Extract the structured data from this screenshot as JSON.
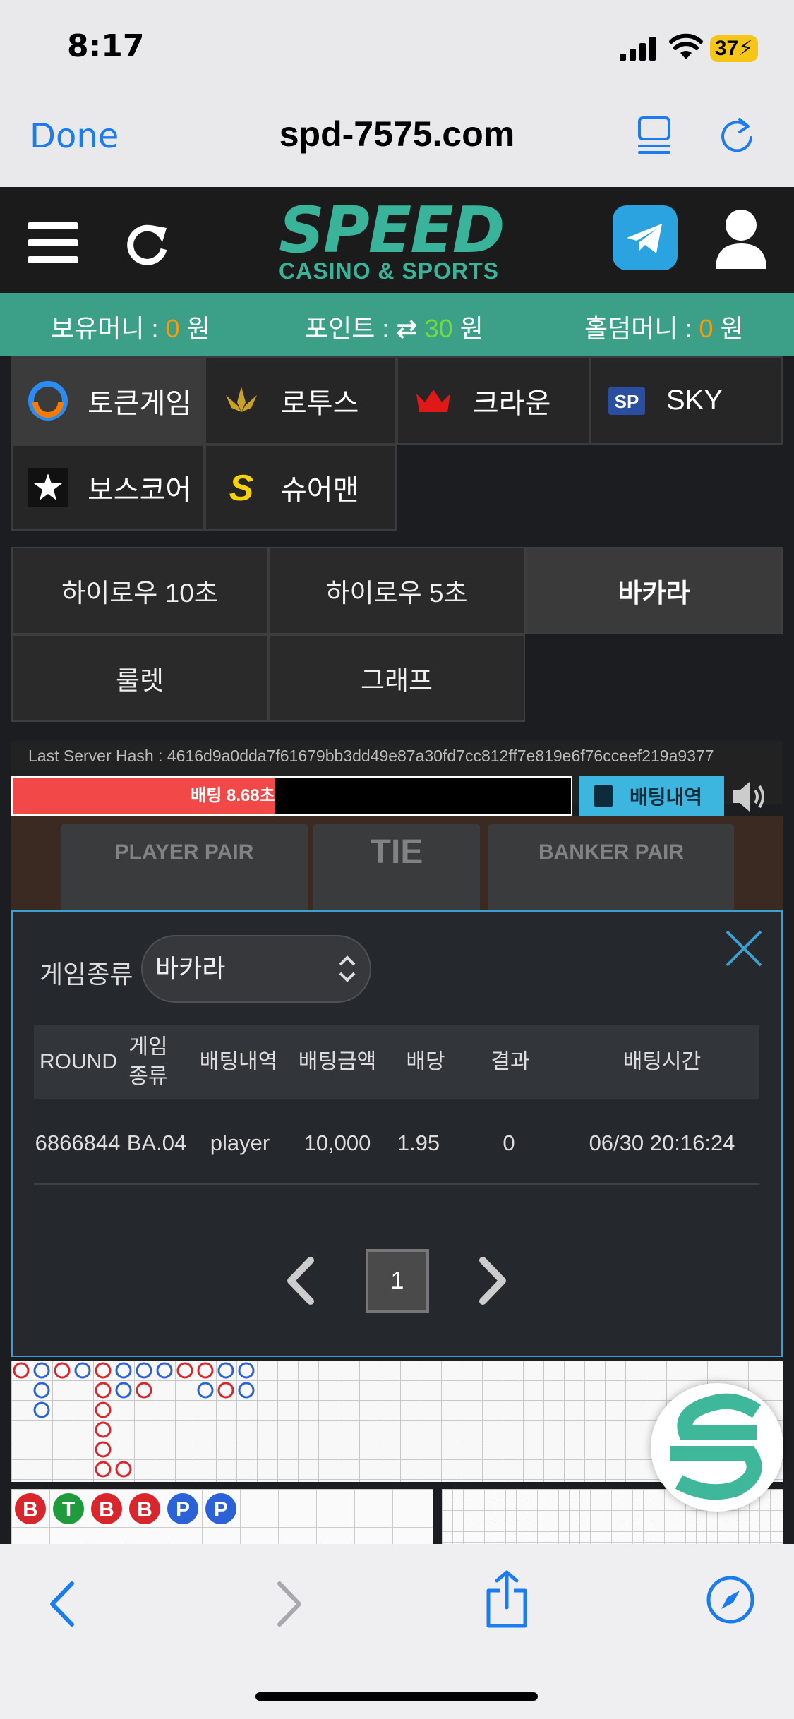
{
  "status": {
    "time": "8:17",
    "battery": "37"
  },
  "browser": {
    "done_label": "Done",
    "url": "spd-7575.com"
  },
  "logo": {
    "line1": "SPEED",
    "line2": "CASINO & SPORTS"
  },
  "money": {
    "held_label": "보유머니 :",
    "held_value": "0",
    "held_unit": "원",
    "point_label": "포인트 :",
    "point_value": "30",
    "point_unit": "원",
    "holdem_label": "홀덤머니 :",
    "holdem_value": "0",
    "holdem_unit": "원"
  },
  "providers": [
    {
      "label": "토큰게임",
      "icon": "token-game-icon"
    },
    {
      "label": "로투스",
      "icon": "lotus-icon"
    },
    {
      "label": "크라운",
      "icon": "crown-icon"
    },
    {
      "label": "SKY",
      "icon": "sky-icon"
    },
    {
      "label": "보스코어",
      "icon": "boscore-icon"
    },
    {
      "label": "슈어맨",
      "icon": "sureman-icon"
    }
  ],
  "game_tabs": [
    "하이로우 10초",
    "하이로우 5초",
    "바카라",
    "룰렛",
    "그래프"
  ],
  "hash": "Last Server Hash : 4616d9a0dda7f61679bb3dd49e87a30fd7cc812ff7e819e6f76cceef219a9377",
  "bet": {
    "timer_text": "배팅 8.68초",
    "progress": 0.47,
    "history_label": "배팅내역"
  },
  "pairs": {
    "player": "PLAYER PAIR",
    "tie": "TIE",
    "banker": "BANKER PAIR"
  },
  "modal": {
    "game_type_label": "게임종류",
    "game_type_value": "바카라",
    "columns": [
      "ROUND",
      "게임종류",
      "배팅내역",
      "배팅금액",
      "배당",
      "결과",
      "배팅시간"
    ],
    "rows": [
      [
        "6866844",
        "BA.04",
        "player",
        "10,000",
        "1.95",
        "0",
        "06/30 20:16:24"
      ]
    ],
    "page": "1"
  },
  "bead": [
    "B",
    "T",
    "B",
    "B",
    "P",
    "P"
  ],
  "colors": {
    "accent_green": "#3c9f87",
    "red": "#f24848",
    "blue": "#3cb6de",
    "orange": "#f39c12"
  }
}
